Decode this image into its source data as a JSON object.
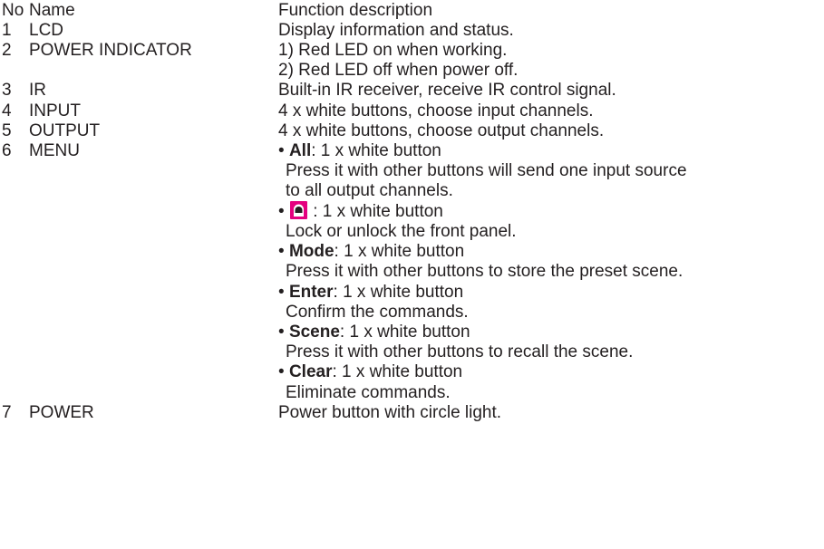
{
  "header": {
    "no": "No",
    "name": "Name",
    "description": "Function description"
  },
  "rows": [
    {
      "no": "1",
      "name": "LCD",
      "description": [
        "Display information and status."
      ]
    },
    {
      "no": "2",
      "name": "POWER INDICATOR",
      "description": [
        "1) Red LED on when working.",
        "2) Red LED off when power off."
      ]
    },
    {
      "no": "3",
      "name": "IR",
      "description": [
        "Built-in IR receiver, receive IR control signal."
      ]
    },
    {
      "no": "4",
      "name": "INPUT",
      "description": [
        "4 x white buttons, choose input channels."
      ]
    },
    {
      "no": "5",
      "name": "OUTPUT",
      "description": [
        "4 x white buttons, choose output channels."
      ]
    },
    {
      "no": "6",
      "name": "MENU",
      "bullets": [
        {
          "label": "All",
          "text": ": 1 x white button",
          "detail": [
            "Press it with other buttons will send one input source",
            "to all output channels."
          ]
        },
        {
          "icon": "lock-icon",
          "text": ": 1 x white button",
          "detail": [
            "Lock or unlock the front panel."
          ]
        },
        {
          "label": "Mode",
          "text": ": 1 x white button",
          "detail": [
            "Press it with other buttons to store the preset scene."
          ]
        },
        {
          "label": "Enter",
          "text": ": 1 x white button",
          "detail": [
            "Confirm the commands."
          ]
        },
        {
          "label": "Scene",
          "text": ": 1 x white button",
          "detail": [
            "Press it with other buttons to recall the scene."
          ]
        },
        {
          "label": "Clear",
          "text": ": 1 x white button",
          "detail": [
            "Eliminate commands."
          ]
        }
      ]
    },
    {
      "no": "7",
      "name": "POWER",
      "description": [
        "Power button with circle light."
      ]
    }
  ],
  "bullet_char": "•",
  "colors": {
    "text": "#231f20",
    "lock_icon_fill": "#e4007f"
  }
}
